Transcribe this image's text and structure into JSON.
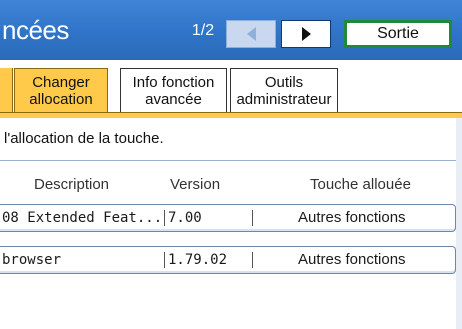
{
  "header": {
    "title": "ncées",
    "page_indicator": "1/2",
    "exit_label": "Sortie",
    "prev_icon": "triangle-left-icon",
    "next_icon": "triangle-right-icon"
  },
  "tabs": [
    {
      "line1": "Changer",
      "line2": "allocation",
      "active": true
    },
    {
      "line1": "Info fonction",
      "line2": "avancée",
      "active": false
    },
    {
      "line1": "Outils",
      "line2": "administrateur",
      "active": false
    }
  ],
  "instruction": "l'allocation de la touche.",
  "table": {
    "headers": {
      "description": "Description",
      "version": "Version",
      "key": "Touche allouée"
    },
    "rows": [
      {
        "description": "08 Extended Feat...",
        "version": "7.00",
        "key": "Autres fonctions"
      },
      {
        "description": "browser",
        "version": "1.79.02",
        "key": "Autres fonctions"
      }
    ]
  },
  "colors": {
    "titlebar": "#3a7fd2",
    "tab_active": "#ffc94a",
    "exit_border": "#1f8a3a"
  }
}
